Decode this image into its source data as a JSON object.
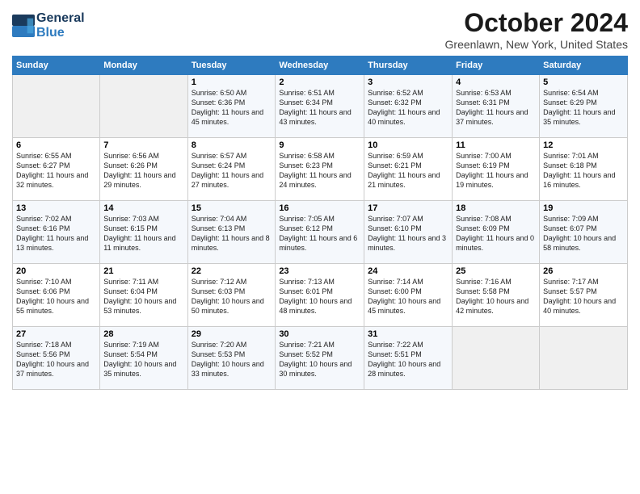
{
  "header": {
    "logo_line1": "General",
    "logo_line2": "Blue",
    "month": "October 2024",
    "location": "Greenlawn, New York, United States"
  },
  "weekdays": [
    "Sunday",
    "Monday",
    "Tuesday",
    "Wednesday",
    "Thursday",
    "Friday",
    "Saturday"
  ],
  "weeks": [
    [
      {
        "day": "",
        "sunrise": "",
        "sunset": "",
        "daylight": ""
      },
      {
        "day": "",
        "sunrise": "",
        "sunset": "",
        "daylight": ""
      },
      {
        "day": "1",
        "sunrise": "Sunrise: 6:50 AM",
        "sunset": "Sunset: 6:36 PM",
        "daylight": "Daylight: 11 hours and 45 minutes."
      },
      {
        "day": "2",
        "sunrise": "Sunrise: 6:51 AM",
        "sunset": "Sunset: 6:34 PM",
        "daylight": "Daylight: 11 hours and 43 minutes."
      },
      {
        "day": "3",
        "sunrise": "Sunrise: 6:52 AM",
        "sunset": "Sunset: 6:32 PM",
        "daylight": "Daylight: 11 hours and 40 minutes."
      },
      {
        "day": "4",
        "sunrise": "Sunrise: 6:53 AM",
        "sunset": "Sunset: 6:31 PM",
        "daylight": "Daylight: 11 hours and 37 minutes."
      },
      {
        "day": "5",
        "sunrise": "Sunrise: 6:54 AM",
        "sunset": "Sunset: 6:29 PM",
        "daylight": "Daylight: 11 hours and 35 minutes."
      }
    ],
    [
      {
        "day": "6",
        "sunrise": "Sunrise: 6:55 AM",
        "sunset": "Sunset: 6:27 PM",
        "daylight": "Daylight: 11 hours and 32 minutes."
      },
      {
        "day": "7",
        "sunrise": "Sunrise: 6:56 AM",
        "sunset": "Sunset: 6:26 PM",
        "daylight": "Daylight: 11 hours and 29 minutes."
      },
      {
        "day": "8",
        "sunrise": "Sunrise: 6:57 AM",
        "sunset": "Sunset: 6:24 PM",
        "daylight": "Daylight: 11 hours and 27 minutes."
      },
      {
        "day": "9",
        "sunrise": "Sunrise: 6:58 AM",
        "sunset": "Sunset: 6:23 PM",
        "daylight": "Daylight: 11 hours and 24 minutes."
      },
      {
        "day": "10",
        "sunrise": "Sunrise: 6:59 AM",
        "sunset": "Sunset: 6:21 PM",
        "daylight": "Daylight: 11 hours and 21 minutes."
      },
      {
        "day": "11",
        "sunrise": "Sunrise: 7:00 AM",
        "sunset": "Sunset: 6:19 PM",
        "daylight": "Daylight: 11 hours and 19 minutes."
      },
      {
        "day": "12",
        "sunrise": "Sunrise: 7:01 AM",
        "sunset": "Sunset: 6:18 PM",
        "daylight": "Daylight: 11 hours and 16 minutes."
      }
    ],
    [
      {
        "day": "13",
        "sunrise": "Sunrise: 7:02 AM",
        "sunset": "Sunset: 6:16 PM",
        "daylight": "Daylight: 11 hours and 13 minutes."
      },
      {
        "day": "14",
        "sunrise": "Sunrise: 7:03 AM",
        "sunset": "Sunset: 6:15 PM",
        "daylight": "Daylight: 11 hours and 11 minutes."
      },
      {
        "day": "15",
        "sunrise": "Sunrise: 7:04 AM",
        "sunset": "Sunset: 6:13 PM",
        "daylight": "Daylight: 11 hours and 8 minutes."
      },
      {
        "day": "16",
        "sunrise": "Sunrise: 7:05 AM",
        "sunset": "Sunset: 6:12 PM",
        "daylight": "Daylight: 11 hours and 6 minutes."
      },
      {
        "day": "17",
        "sunrise": "Sunrise: 7:07 AM",
        "sunset": "Sunset: 6:10 PM",
        "daylight": "Daylight: 11 hours and 3 minutes."
      },
      {
        "day": "18",
        "sunrise": "Sunrise: 7:08 AM",
        "sunset": "Sunset: 6:09 PM",
        "daylight": "Daylight: 11 hours and 0 minutes."
      },
      {
        "day": "19",
        "sunrise": "Sunrise: 7:09 AM",
        "sunset": "Sunset: 6:07 PM",
        "daylight": "Daylight: 10 hours and 58 minutes."
      }
    ],
    [
      {
        "day": "20",
        "sunrise": "Sunrise: 7:10 AM",
        "sunset": "Sunset: 6:06 PM",
        "daylight": "Daylight: 10 hours and 55 minutes."
      },
      {
        "day": "21",
        "sunrise": "Sunrise: 7:11 AM",
        "sunset": "Sunset: 6:04 PM",
        "daylight": "Daylight: 10 hours and 53 minutes."
      },
      {
        "day": "22",
        "sunrise": "Sunrise: 7:12 AM",
        "sunset": "Sunset: 6:03 PM",
        "daylight": "Daylight: 10 hours and 50 minutes."
      },
      {
        "day": "23",
        "sunrise": "Sunrise: 7:13 AM",
        "sunset": "Sunset: 6:01 PM",
        "daylight": "Daylight: 10 hours and 48 minutes."
      },
      {
        "day": "24",
        "sunrise": "Sunrise: 7:14 AM",
        "sunset": "Sunset: 6:00 PM",
        "daylight": "Daylight: 10 hours and 45 minutes."
      },
      {
        "day": "25",
        "sunrise": "Sunrise: 7:16 AM",
        "sunset": "Sunset: 5:58 PM",
        "daylight": "Daylight: 10 hours and 42 minutes."
      },
      {
        "day": "26",
        "sunrise": "Sunrise: 7:17 AM",
        "sunset": "Sunset: 5:57 PM",
        "daylight": "Daylight: 10 hours and 40 minutes."
      }
    ],
    [
      {
        "day": "27",
        "sunrise": "Sunrise: 7:18 AM",
        "sunset": "Sunset: 5:56 PM",
        "daylight": "Daylight: 10 hours and 37 minutes."
      },
      {
        "day": "28",
        "sunrise": "Sunrise: 7:19 AM",
        "sunset": "Sunset: 5:54 PM",
        "daylight": "Daylight: 10 hours and 35 minutes."
      },
      {
        "day": "29",
        "sunrise": "Sunrise: 7:20 AM",
        "sunset": "Sunset: 5:53 PM",
        "daylight": "Daylight: 10 hours and 33 minutes."
      },
      {
        "day": "30",
        "sunrise": "Sunrise: 7:21 AM",
        "sunset": "Sunset: 5:52 PM",
        "daylight": "Daylight: 10 hours and 30 minutes."
      },
      {
        "day": "31",
        "sunrise": "Sunrise: 7:22 AM",
        "sunset": "Sunset: 5:51 PM",
        "daylight": "Daylight: 10 hours and 28 minutes."
      },
      {
        "day": "",
        "sunrise": "",
        "sunset": "",
        "daylight": ""
      },
      {
        "day": "",
        "sunrise": "",
        "sunset": "",
        "daylight": ""
      }
    ]
  ]
}
